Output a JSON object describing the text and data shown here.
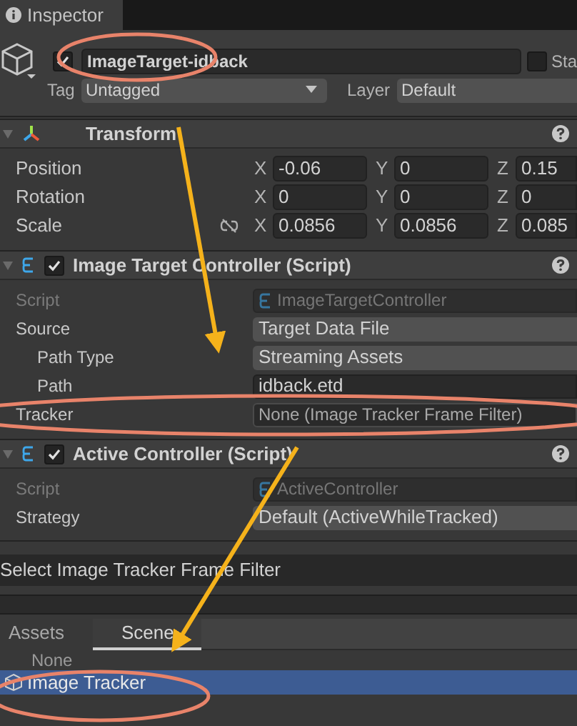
{
  "tab": {
    "label": "Inspector"
  },
  "object": {
    "active": true,
    "name": "ImageTarget-idback",
    "static": false,
    "static_label": "Sta",
    "tag_label": "Tag",
    "tag": "Untagged",
    "layer_label": "Layer",
    "layer": "Default"
  },
  "components": [
    {
      "kind": "transform",
      "title": "Transform",
      "expanded": true,
      "rows": [
        {
          "label": "Position",
          "values": [
            {
              "axis": "X",
              "value": "-0.06"
            },
            {
              "axis": "Y",
              "value": "0"
            },
            {
              "axis": "Z",
              "value": "0.15"
            }
          ]
        },
        {
          "label": "Rotation",
          "values": [
            {
              "axis": "X",
              "value": "0"
            },
            {
              "axis": "Y",
              "value": "0"
            },
            {
              "axis": "Z",
              "value": "0"
            }
          ]
        },
        {
          "label": "Scale",
          "proportional": false,
          "values": [
            {
              "axis": "X",
              "value": "0.0856"
            },
            {
              "axis": "Y",
              "value": "0.0856"
            },
            {
              "axis": "Z",
              "value": "0.085"
            }
          ]
        }
      ]
    },
    {
      "kind": "script",
      "title": "Image Target Controller (Script)",
      "expanded": true,
      "enabled": true,
      "fields": [
        {
          "label": "Script",
          "value": "ImageTargetController",
          "kind": "script_ref",
          "disabled": true
        },
        {
          "label": "Source",
          "value": "Target Data File",
          "kind": "dropdown",
          "disabled": false,
          "children": [
            {
              "label": "Path Type",
              "value": "Streaming Assets",
              "kind": "dropdown",
              "disabled": false
            },
            {
              "label": "Path",
              "value": "idback.etd",
              "kind": "text",
              "disabled": false
            }
          ]
        },
        {
          "label": "Tracker",
          "value": "None (Image Tracker Frame Filter)",
          "kind": "object_ref",
          "disabled": false
        }
      ]
    },
    {
      "kind": "script",
      "title": "Active Controller (Script)",
      "expanded": true,
      "enabled": true,
      "fields": [
        {
          "label": "Script",
          "value": "ActiveController",
          "kind": "script_ref",
          "disabled": true
        },
        {
          "label": "Strategy",
          "value": "Default (ActiveWhileTracked)",
          "kind": "dropdown",
          "disabled": false
        }
      ]
    }
  ],
  "picker": {
    "title": "Select Image Tracker Frame Filter",
    "tabs": [
      {
        "label": "Assets",
        "selected": false
      },
      {
        "label": "Scene",
        "selected": true
      }
    ],
    "items": [
      {
        "label": "None",
        "kind": "none",
        "selected": false
      },
      {
        "label": "Image Tracker",
        "kind": "object",
        "selected": true
      }
    ]
  }
}
